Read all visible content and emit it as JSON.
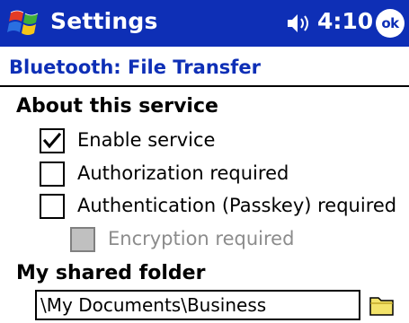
{
  "titlebar": {
    "title": "Settings",
    "time": "4:10",
    "ok_label": "ok"
  },
  "page": {
    "title": "Bluetooth: File Transfer"
  },
  "about_section": {
    "heading": "About this service",
    "options": [
      {
        "label": "Enable service",
        "checked": true,
        "enabled": true
      },
      {
        "label": "Authorization required",
        "checked": false,
        "enabled": true
      },
      {
        "label": "Authentication (Passkey) required",
        "checked": false,
        "enabled": true
      },
      {
        "label": "Encryption required",
        "checked": false,
        "enabled": false
      }
    ]
  },
  "folder_section": {
    "heading": "My shared folder",
    "path": "\\My Documents\\Business"
  },
  "colors": {
    "titlebar_bg": "#0e2fb6",
    "page_title": "#0e2fb6",
    "folder_icon": "#f3e36a"
  },
  "icons": [
    "windows-start-icon",
    "speaker-icon",
    "checkmark-icon",
    "folder-icon"
  ]
}
